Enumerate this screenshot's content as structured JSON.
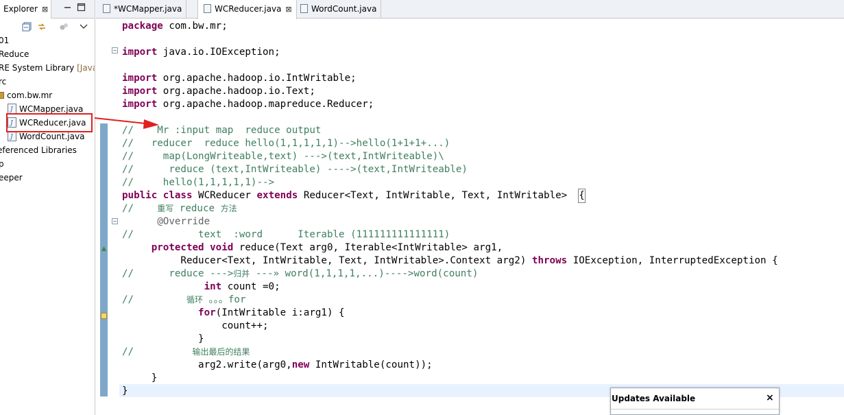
{
  "explorer": {
    "tab_label": "Explorer",
    "close_glyph": "⊠",
    "tree": [
      {
        "label": "01"
      },
      {
        "label": "Reduce"
      },
      {
        "label": "RE System Library",
        "suffix": "[JavaS"
      },
      {
        "label": "rc"
      },
      {
        "label": "com.bw.mr"
      },
      {
        "label": "WCMapper.java"
      },
      {
        "label": "WCReducer.java"
      },
      {
        "label": "WordCount.java"
      },
      {
        "label": "eferenced Libraries"
      },
      {
        "label": "p"
      },
      {
        "label": "eeper"
      }
    ]
  },
  "editor": {
    "tabs": [
      {
        "label": "*WCMapper.java"
      },
      {
        "label": "WCReducer.java",
        "close": "⊠"
      },
      {
        "label": "WordCount.java"
      }
    ]
  },
  "code_lines": [
    "package com.bw.mr;",
    "",
    "import java.io.IOException;",
    "",
    "import org.apache.hadoop.io.IntWritable;",
    "import org.apache.hadoop.io.Text;",
    "import org.apache.hadoop.mapreduce.Reducer;",
    "",
    "//    Mr :input map  reduce output",
    "//   reducer  reduce hello(1,1,1,1,1)-->hello(1+1+1+...)",
    "//     map(LongWriteable,text) --->(text,IntWriteable)\\",
    "//      reduce (text,IntWriteable) ---->(text,IntWriteable)",
    "//     hello(1,1,1,1,1)-->",
    "public class WCReducer extends Reducer<Text, IntWritable, Text, IntWritable>  {",
    "//    重写 reduce 方法",
    "      @Override",
    "//           text  :word      Iterable (111111111111111)",
    "     protected void reduce(Text arg0, Iterable<IntWritable> arg1,",
    "               Reducer<Text, IntWritable, Text, IntWritable>.Context arg2) throws IOException, InterruptedException {",
    "//      reduce --->归并 ---» word(1,1,1,1,...)---->word(count)",
    "              int count =0;",
    "//         循环 。。。for",
    "             for(IntWritable i:arg1) {",
    "                 count++;",
    "             }",
    "//          输出最后的结果",
    "             arg2.write(arg0,new IntWritable(count));",
    "     }",
    "}"
  ],
  "updates_popup": {
    "title": "Updates Available",
    "close_glyph": "×"
  },
  "colors": {
    "keyword": "#7f0055",
    "comment": "#3f7f5f",
    "annotation": "#646464",
    "highlight_box": "#e02020",
    "ruler": "#7fa7c9"
  }
}
